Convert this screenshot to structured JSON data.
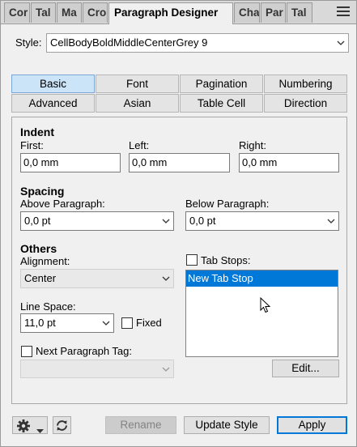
{
  "tabs": [
    {
      "label": "Cor"
    },
    {
      "label": "Tal"
    },
    {
      "label": "Ma"
    },
    {
      "label": "Cro"
    },
    {
      "label": "Paragraph Designer"
    },
    {
      "label": "Cha"
    },
    {
      "label": "Par"
    },
    {
      "label": "Tal"
    }
  ],
  "style": {
    "label": "Style:",
    "value": "CellBodyBoldMiddleCenterGrey 9"
  },
  "section_tabs": {
    "row1": [
      "Basic",
      "Font",
      "Pagination",
      "Numbering"
    ],
    "row2": [
      "Advanced",
      "Asian",
      "Table Cell",
      "Direction"
    ]
  },
  "indent": {
    "heading": "Indent",
    "first_label": "First:",
    "first_value": "0,0 mm",
    "left_label": "Left:",
    "left_value": "0,0 mm",
    "right_label": "Right:",
    "right_value": "0,0 mm"
  },
  "spacing": {
    "heading": "Spacing",
    "above_label": "Above Paragraph:",
    "above_value": "0,0 pt",
    "below_label": "Below Paragraph:",
    "below_value": "0,0 pt"
  },
  "others": {
    "heading": "Others",
    "alignment_label": "Alignment:",
    "alignment_value": "Center",
    "linespace_label": "Line Space:",
    "linespace_value": "11,0 pt",
    "fixed_label": "Fixed",
    "next_tag_label": "Next Paragraph Tag:"
  },
  "tabstops": {
    "label": "Tab Stops:",
    "items": [
      "New Tab Stop"
    ],
    "edit_label": "Edit..."
  },
  "footer": {
    "rename_label": "Rename",
    "update_label": "Update Style",
    "apply_label": "Apply"
  }
}
